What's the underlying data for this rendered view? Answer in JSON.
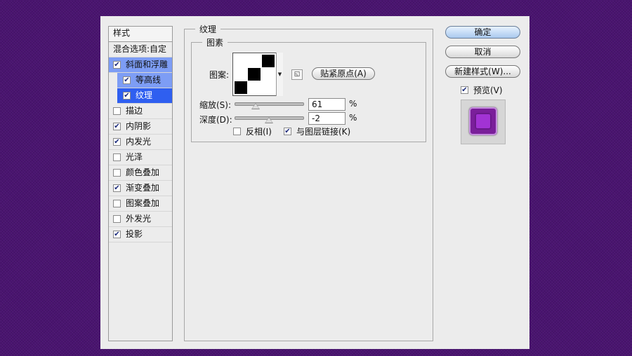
{
  "left_panel": {
    "title": "样式",
    "blending": "混合选项:自定",
    "items": [
      {
        "label": "斜面和浮雕",
        "checked": true
      },
      {
        "label": "等高线",
        "checked": true
      },
      {
        "label": "纹理",
        "checked": true
      },
      {
        "label": "描边",
        "checked": false
      },
      {
        "label": "内阴影",
        "checked": true
      },
      {
        "label": "内发光",
        "checked": true
      },
      {
        "label": "光泽",
        "checked": false
      },
      {
        "label": "颜色叠加",
        "checked": false
      },
      {
        "label": "渐变叠加",
        "checked": true
      },
      {
        "label": "图案叠加",
        "checked": false
      },
      {
        "label": "外发光",
        "checked": false
      },
      {
        "label": "投影",
        "checked": true
      }
    ]
  },
  "texture": {
    "group_title": "纹理",
    "sub_title": "图素",
    "pattern_label": "图案:",
    "snap_button": "贴紧原点(A)",
    "scale_label": "缩放(S):",
    "scale_value": "61",
    "scale_unit": "%",
    "scale_slider": 0.61,
    "depth_label": "深度(D):",
    "depth_value": "-2",
    "depth_unit": "%",
    "invert_label": "反相(I)",
    "invert_checked": false,
    "link_label": "与图层链接(K)",
    "link_checked": true
  },
  "buttons": {
    "ok": "确定",
    "cancel": "取消",
    "new_style": "新建样式(W)...",
    "preview_label": "预览(V)",
    "preview_checked": true
  },
  "colors": {
    "background": "#4a1470",
    "dialog": "#ececec",
    "selection_light": "#7d9df5",
    "selection_dark": "#2f5ff0",
    "preview_purple": "#a233d4"
  }
}
